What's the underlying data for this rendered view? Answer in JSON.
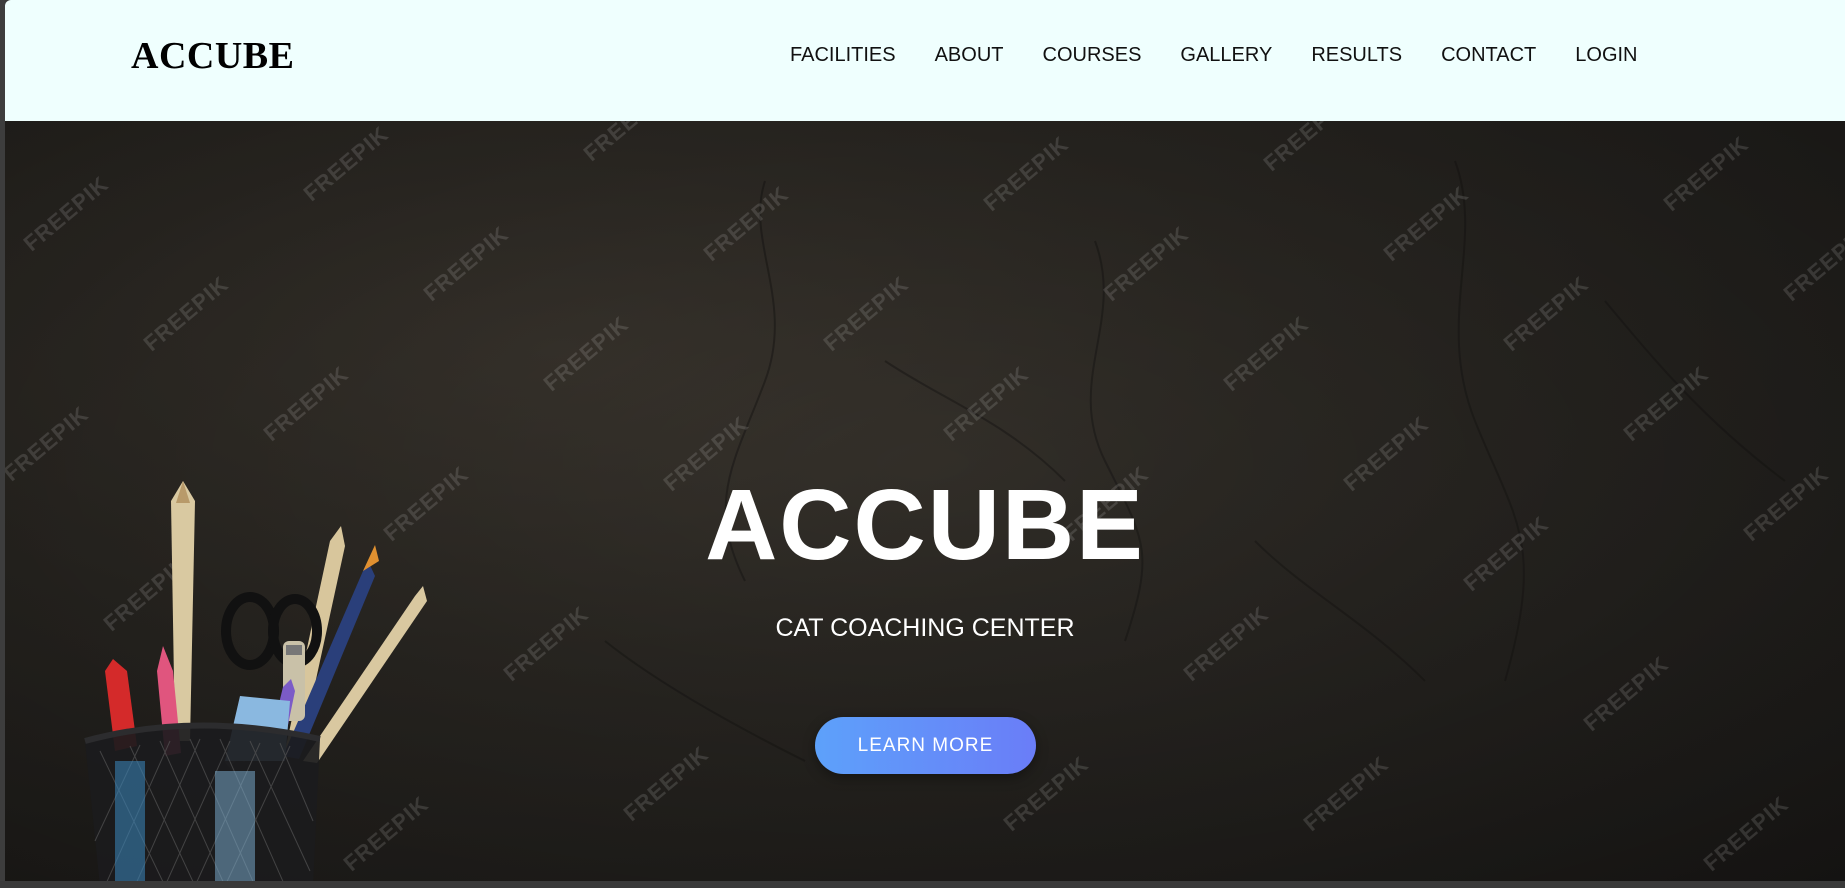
{
  "brand": {
    "name": "ACCUBE"
  },
  "nav": {
    "items": [
      {
        "label": "FACILITIES"
      },
      {
        "label": "ABOUT"
      },
      {
        "label": "COURSES"
      },
      {
        "label": "GALLERY"
      },
      {
        "label": "RESULTS"
      },
      {
        "label": "CONTACT"
      },
      {
        "label": "LOGIN"
      }
    ]
  },
  "hero": {
    "title": "ACCUBE",
    "subtitle": "CAT COACHING CENTER",
    "cta_label": "LEARN MORE",
    "watermark_text": "FREEPIK"
  },
  "colors": {
    "navbar_bg": "#effffe",
    "hero_bg": "#2b2824",
    "cta_start": "#5da1fa",
    "cta_end": "#6a7df8"
  },
  "icons": {
    "hero_illustration": "pencil-cup-icon"
  }
}
